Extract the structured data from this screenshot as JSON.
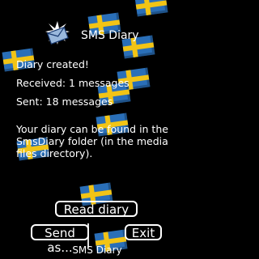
{
  "app": {
    "title": "SMS Diary",
    "icon": "envelope-sparkle-icon"
  },
  "status": {
    "created": "Diary created!",
    "received": "Received: 1 messages",
    "sent": "Sent: 18 messages",
    "location_note": "Your diary can be found in the SmsDiary folder (in the media files directory)."
  },
  "buttons": {
    "read": "Read diary",
    "send": "Send as...",
    "exit": "Exit"
  },
  "footer": {
    "label": "SMS Diary"
  },
  "colors": {
    "background": "#000000",
    "flag_blue": "#2a6fb8",
    "flag_yellow": "#f2c415",
    "text": "#ffffff"
  }
}
